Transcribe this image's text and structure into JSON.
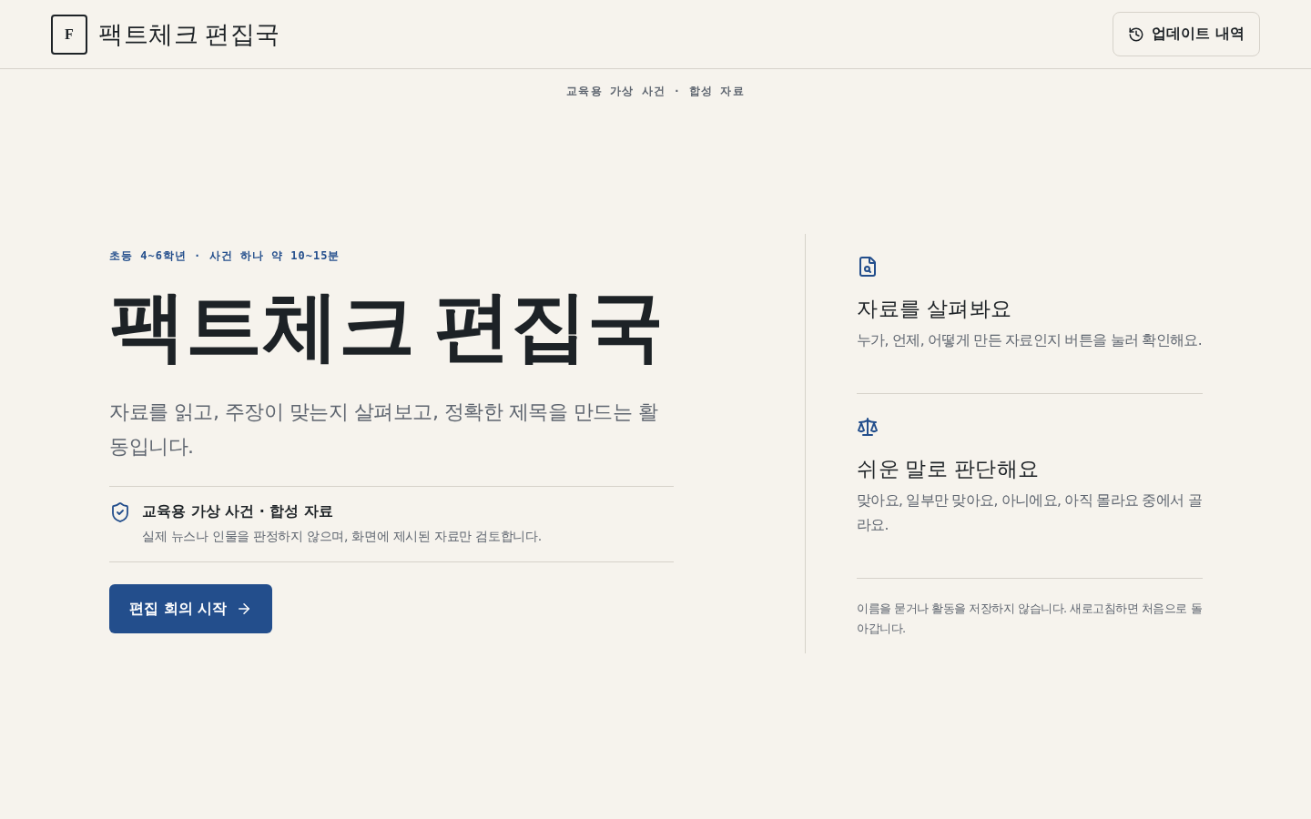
{
  "header": {
    "logo_letter": "F",
    "title": "팩트체크 편집국",
    "update_button": {
      "label": "업데이트 내역"
    }
  },
  "tagline": "교육용 가상 사건 · 합성 자료",
  "hero": {
    "eyebrow": "초등 4~6학년 · 사건 하나 약 10~15분",
    "title": "팩트체크 편집국",
    "lead": "자료를 읽고, 주장이 맞는지 살펴보고, 정확한 제목을 만드는 활동입니다.",
    "notice": {
      "title": "교육용 가상 사건 · 합성 자료",
      "text": "실제 뉴스나 인물을 판정하지 않으며, 화면에 제시된 자료만 검토합니다."
    },
    "start_button": {
      "label": "편집 회의 시작"
    }
  },
  "features": [
    {
      "kind": "document-search",
      "title": "자료를 살펴봐요",
      "text": "누가, 언제, 어떻게 만든 자료인지 버튼을 눌러 확인해요."
    },
    {
      "kind": "scale",
      "title": "쉬운 말로 판단해요",
      "text": "맞아요, 일부만 맞아요, 아니에요, 아직 몰라요 중에서 골라요."
    }
  ],
  "footnote": "이름을 묻거나 활동을 저장하지 않습니다. 새로고침하면 처음으로 돌아갑니다."
}
